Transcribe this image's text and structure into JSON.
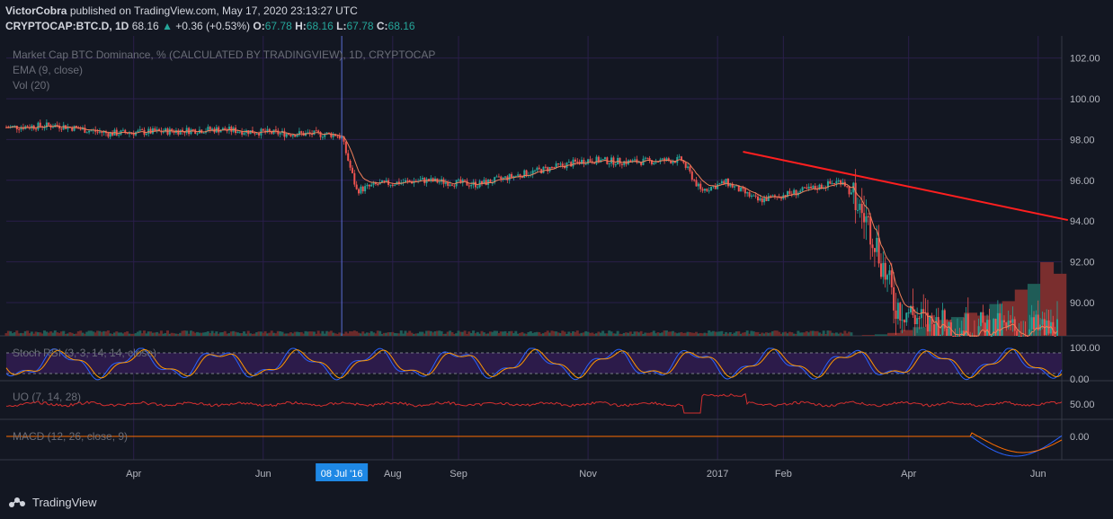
{
  "header": {
    "author": "VictorCobra",
    "published": "published on TradingView.com, May 17, 2020 23:13:27 UTC",
    "symbol": "CRYPTOCAP:BTC.D, 1D",
    "last": "68.16",
    "change": "+0.36 (+0.53%)",
    "o_label": "O:",
    "o": "67.78",
    "h_label": "H:",
    "h": "68.16",
    "l_label": "L:",
    "l": "67.78",
    "c_label": "C:",
    "c": "68.16"
  },
  "legend": {
    "title": "Market Cap BTC Dominance, % (CALCULATED BY TRADINGVIEW), 1D, CRYPTOCAP",
    "ema": "EMA (9, close)",
    "vol": "Vol (20)",
    "stoch": "Stoch RSI (3, 3, 14, 14, close)",
    "uo": "UO (7, 14, 28)",
    "macd": "MACD (12, 26, close, 9)"
  },
  "footer": {
    "brand": "TradingView"
  },
  "colors": {
    "bg": "#131722",
    "up": "#26a69a",
    "down": "#ef5350",
    "trend": "#ff1f1f",
    "grid": "#2a1f4a"
  },
  "chart_data": {
    "type": "candlestick",
    "x_ticks": [
      "Apr",
      "Jun",
      "Aug",
      "Sep",
      "Nov",
      "2017",
      "Feb",
      "Apr",
      "Jun"
    ],
    "crosshair_label": "08 Jul '16",
    "y_ticks": [
      "102.00",
      "100.00",
      "98.00",
      "96.00",
      "94.00",
      "92.00",
      "90.00"
    ],
    "ylim": [
      88.5,
      103.2
    ],
    "price_path": [
      {
        "date": "2016-02-01",
        "value": 98.6
      },
      {
        "date": "2016-02-25",
        "value": 98.7
      },
      {
        "date": "2016-03-20",
        "value": 98.3
      },
      {
        "date": "2016-04-15",
        "value": 98.4
      },
      {
        "date": "2016-05-10",
        "value": 98.5
      },
      {
        "date": "2016-06-10",
        "value": 98.3
      },
      {
        "date": "2016-07-05",
        "value": 98.25
      },
      {
        "date": "2016-07-08",
        "value": 98.1
      },
      {
        "date": "2016-07-15",
        "value": 95.5
      },
      {
        "date": "2016-07-25",
        "value": 95.8
      },
      {
        "date": "2016-08-15",
        "value": 96.0
      },
      {
        "date": "2016-09-10",
        "value": 95.8
      },
      {
        "date": "2016-10-01",
        "value": 96.3
      },
      {
        "date": "2016-11-01",
        "value": 97.0
      },
      {
        "date": "2016-11-20",
        "value": 96.9
      },
      {
        "date": "2016-12-15",
        "value": 97.0
      },
      {
        "date": "2016-12-24",
        "value": 95.5
      },
      {
        "date": "2017-01-05",
        "value": 95.9
      },
      {
        "date": "2017-01-20",
        "value": 95.0
      },
      {
        "date": "2017-02-15",
        "value": 95.6
      },
      {
        "date": "2017-03-01",
        "value": 96.0
      },
      {
        "date": "2017-03-15",
        "value": 93.5
      },
      {
        "date": "2017-03-25",
        "value": 90.0
      },
      {
        "date": "2017-04-10",
        "value": 88.9
      },
      {
        "date": "2017-05-10",
        "value": 88.6
      },
      {
        "date": "2017-06-10",
        "value": 88.6
      }
    ],
    "trendline": [
      {
        "date": "2017-01-13",
        "value": 97.4
      },
      {
        "date": "2017-06-15",
        "value": 94.05
      }
    ],
    "volume_tail": [
      0.5,
      1,
      2,
      4,
      6,
      8,
      11,
      13,
      16,
      14,
      22,
      24,
      32,
      36,
      51,
      43
    ],
    "stoch_rsi_ticks": [
      "100.00",
      "0.00"
    ],
    "uo_tick": "50.00",
    "macd_tick": "0.00"
  }
}
